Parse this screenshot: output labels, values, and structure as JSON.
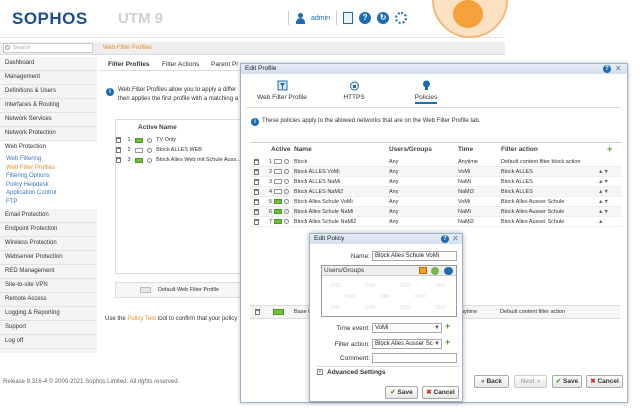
{
  "header": {
    "logo": "SOPHOS",
    "product": "UTM 9",
    "user": "admin",
    "icons": [
      "user-icon",
      "document-icon",
      "help-icon",
      "refresh-icon",
      "ring-icon"
    ]
  },
  "search": {
    "placeholder": "Search"
  },
  "breadcrumb": "Web Filter Profiles",
  "sidebar": {
    "items": [
      {
        "label": "Dashboard"
      },
      {
        "label": "Management"
      },
      {
        "label": "Definitions & Users"
      },
      {
        "label": "Interfaces & Routing"
      },
      {
        "label": "Network Services"
      },
      {
        "label": "Network Protection"
      },
      {
        "label": "Web Protection"
      },
      {
        "label": "Email Protection"
      },
      {
        "label": "Endpoint Protection"
      },
      {
        "label": "Wireless Protection"
      },
      {
        "label": "Webserver Protection"
      },
      {
        "label": "RED Management"
      },
      {
        "label": "Site-to-site VPN"
      },
      {
        "label": "Remote Access"
      },
      {
        "label": "Logging & Reporting"
      },
      {
        "label": "Support"
      },
      {
        "label": "Log off"
      }
    ],
    "web_sub": [
      "Web Filtering",
      "Web Filter Profiles",
      "Filtering Options",
      "Policy Helpdesk",
      "Application Control",
      "FTP"
    ]
  },
  "main": {
    "tabs": [
      "Filter Profiles",
      "Filter Actions",
      "Parent Pr"
    ],
    "info": "Web Filter Profiles allow you to apply a differ then applies the first profile with a matching a",
    "list_headers": {
      "active": "Active",
      "name": "Name"
    },
    "list_rows": [
      {
        "num": "1",
        "name": "TV Only",
        "active": true
      },
      {
        "num": "2",
        "name": "Block ALLES WEB",
        "active": false
      },
      {
        "num": "3",
        "name": "Block Alles Web mit Schule Auss...",
        "active": true
      }
    ],
    "default_profile": "Default Web Filter Profile",
    "footer_pre": "Use the",
    "footer_link": "Policy Test",
    "footer_post": "tool to confirm that your policy"
  },
  "release": "Release 9.316-4  © 2000-2021 Sophos Limited. All rights reserved.",
  "edit_profile": {
    "title": "Edit Profile",
    "tabs": [
      {
        "label": "Web Filter Profile"
      },
      {
        "label": "HTTPS"
      },
      {
        "label": "Policies"
      }
    ],
    "info": "These policies apply to the allowed networks that are on the Web Filter Profile tab.",
    "columns": {
      "active": "Active",
      "name": "Name",
      "users": "Users/Groups",
      "time": "Time",
      "action": "Filter action"
    },
    "rows": [
      {
        "num": "1",
        "name": "Block",
        "users": "Any",
        "time": "Anytime",
        "action": "Default content filter block action",
        "active": false
      },
      {
        "num": "2",
        "name": "Block ALLES VoMi",
        "users": "Any",
        "time": "VoMi",
        "action": "Block ALLES",
        "active": false
      },
      {
        "num": "3",
        "name": "Block ALLES NaMi",
        "users": "Any",
        "time": "NaMi",
        "action": "Block ALLES",
        "active": false
      },
      {
        "num": "4",
        "name": "Block ALLES NaMi2",
        "users": "Any",
        "time": "NaMi2",
        "action": "Block ALLES",
        "active": false
      },
      {
        "num": "5",
        "name": "Block Alles Schule VoMi",
        "users": "Any",
        "time": "VoMi",
        "action": "Block Alles Ausser Schule",
        "active": true
      },
      {
        "num": "6",
        "name": "Block Alles Schule NaMi",
        "users": "Any",
        "time": "NaMi",
        "action": "Block Alles Ausser Schule",
        "active": true
      },
      {
        "num": "7",
        "name": "Block Alles Schule NaMi2",
        "users": "Any",
        "time": "NaMi2",
        "action": "Block Alles Ausser Schule",
        "active": true
      }
    ],
    "base": {
      "name": "Base F",
      "time": "nytime",
      "action": "Default content filter action"
    },
    "buttons": {
      "back": "Back",
      "next": "Next",
      "save": "Save",
      "cancel": "Cancel"
    }
  },
  "edit_policy": {
    "title": "Edit Policy",
    "name_label": "Name:",
    "name_value": "Block Alles Schule VoMi",
    "users_header": "Users/Groups",
    "dnd": "DND",
    "time_label": "Time event:",
    "time_value": "VoMi",
    "filter_label": "Filter action:",
    "filter_value": "Block Alles Ausser Sc",
    "comment_label": "Comment:",
    "comment_value": "",
    "advanced": "Advanced Settings",
    "save": "Save",
    "cancel": "Cancel"
  },
  "colors": {
    "brand": "#1c4f8c",
    "accent": "#f08a24",
    "active_green": "#6bbf3a",
    "link_blue": "#1c6cb0"
  }
}
